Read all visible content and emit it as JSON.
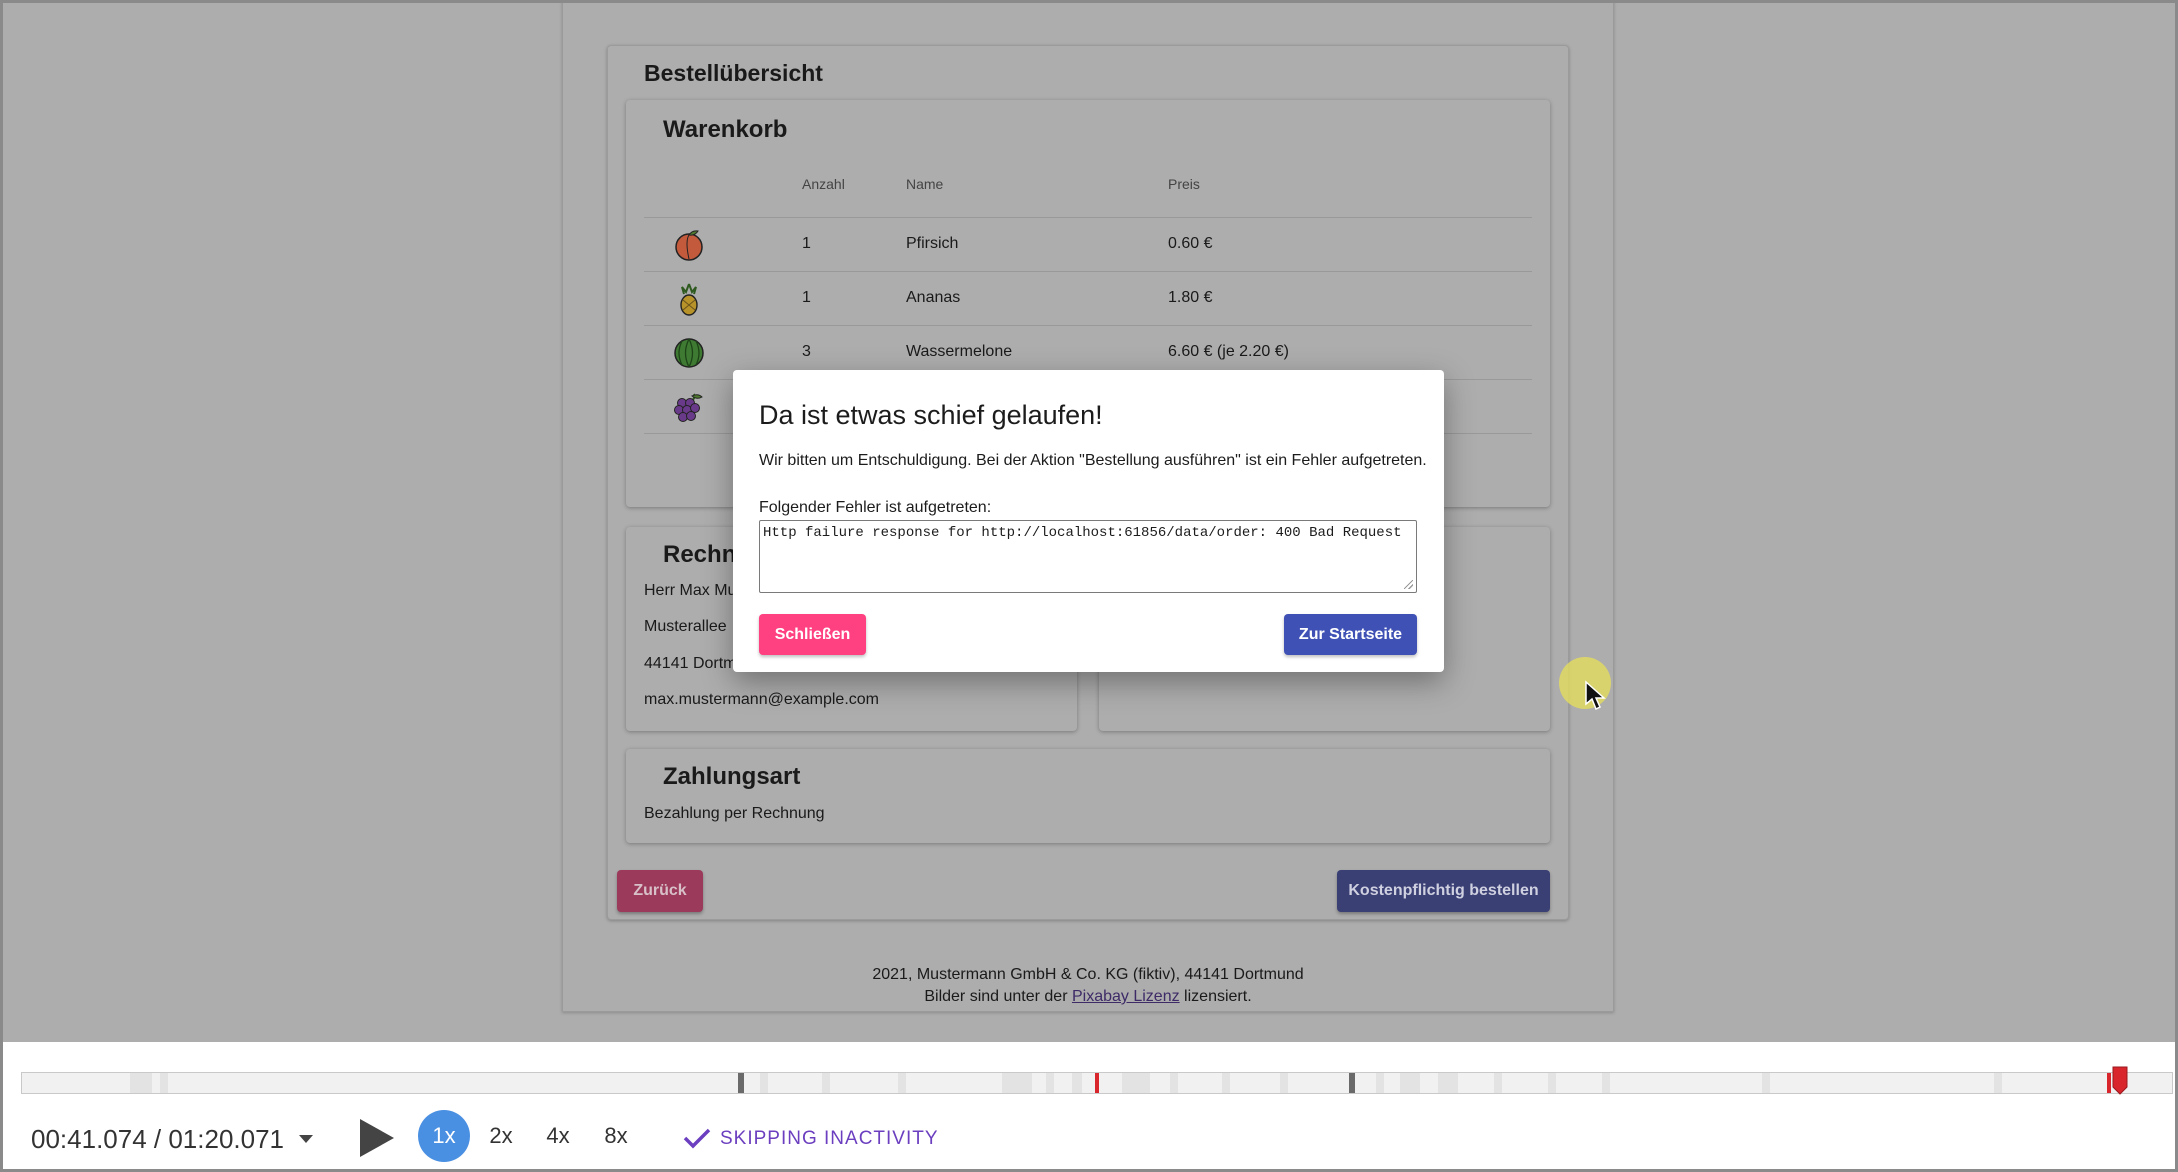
{
  "order": {
    "heading": "Bestellübersicht",
    "cart": {
      "heading": "Warenkorb",
      "columns": {
        "qty": "Anzahl",
        "name": "Name",
        "price": "Preis"
      },
      "rows": [
        {
          "icon": "peach-icon",
          "qty": "1",
          "name": "Pfirsich",
          "price": "0.60 €"
        },
        {
          "icon": "pineapple-icon",
          "qty": "1",
          "name": "Ananas",
          "price": "1.80 €"
        },
        {
          "icon": "watermelon-icon",
          "qty": "3",
          "name": "Wassermelone",
          "price": "6.60 € (je 2.20 €)"
        },
        {
          "icon": "grapes-icon",
          "qty": "",
          "name": "",
          "price": ""
        }
      ]
    },
    "billing": {
      "heading": "Rechnu",
      "name": "Herr Max Mu",
      "street": "Musterallee",
      "city": "44141 Dortm",
      "email": "max.mustermann@example.com"
    },
    "payment": {
      "heading": "Zahlungsart",
      "method": "Bezahlung per Rechnung"
    },
    "back_label": "Zurück",
    "order_label": "Kostenpflichtig bestellen"
  },
  "footer": {
    "line1": "2021, Mustermann GmbH & Co. KG (fiktiv), 44141 Dortmund",
    "line2_pre": "Bilder sind unter der ",
    "link": "Pixabay Lizenz",
    "line2_post": " lizensiert."
  },
  "dialog": {
    "title": "Da ist etwas schief gelaufen!",
    "message": "Wir bitten um Entschuldigung. Bei der Aktion \"Bestellung ausführen\" ist ein Fehler aufgetreten.",
    "error_label": "Folgender Fehler ist aufgetreten:",
    "error_text": "Http failure response for http://localhost:61856/data/order: 400 Bad Request",
    "close_label": "Schließen",
    "home_label": "Zur Startseite"
  },
  "player": {
    "time": "00:41.074 / 01:20.071",
    "speeds": [
      "1x",
      "2x",
      "4x",
      "8x"
    ],
    "active_speed": "1x",
    "skip_label": "SKIPPING INACTIVITY",
    "progress": 0.513,
    "colors": {
      "accent": "#4a90e2",
      "skip": "#6b3fbf",
      "error_marker": "#d8262c"
    }
  }
}
